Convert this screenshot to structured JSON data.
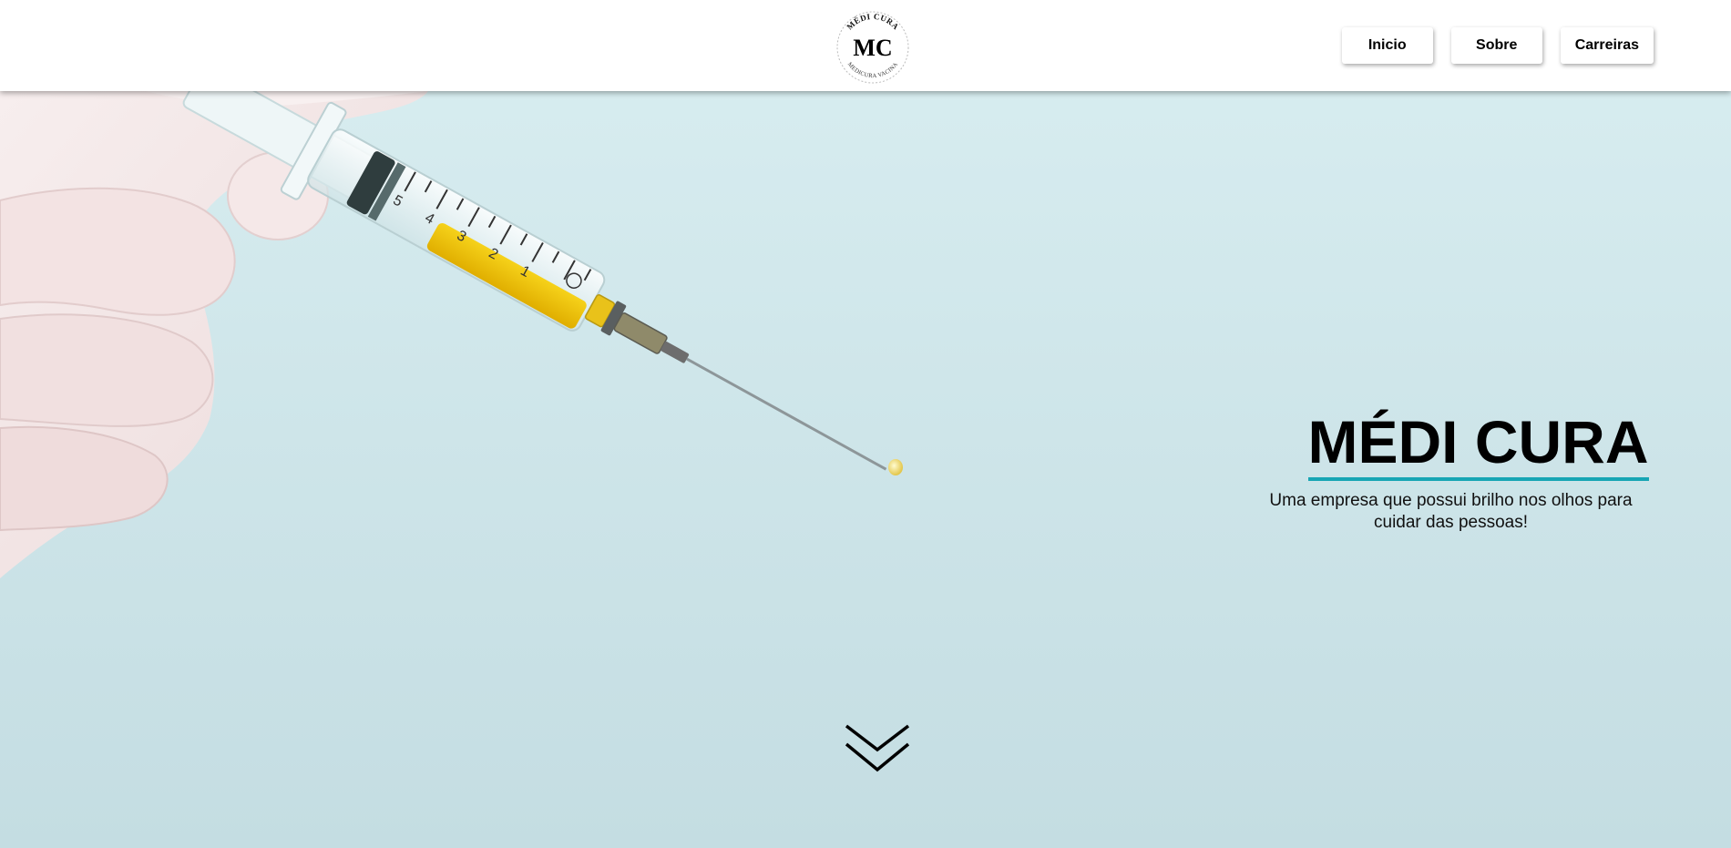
{
  "header": {
    "logo": {
      "monogram": "MC",
      "ring_top": "MÉDI CURA",
      "ring_bottom": "MEDICURA VACINA"
    },
    "nav": [
      {
        "label": "Inicio"
      },
      {
        "label": "Sobre"
      },
      {
        "label": "Carreiras"
      }
    ]
  },
  "hero": {
    "title": "MÉDI CURA",
    "subtitle_line1": "Uma empresa que possui brilho nos olhos para",
    "subtitle_line2": "cuidar das pessoas!",
    "syringe_marks": [
      "5",
      "4",
      "3",
      "2",
      "1"
    ],
    "scroll_icon": "double-chevron-down-icon"
  },
  "colors": {
    "accent": "#17a5b4",
    "background": "#d3e8ec",
    "liquid": "#f2c400",
    "glove": "#f4e6e6"
  }
}
